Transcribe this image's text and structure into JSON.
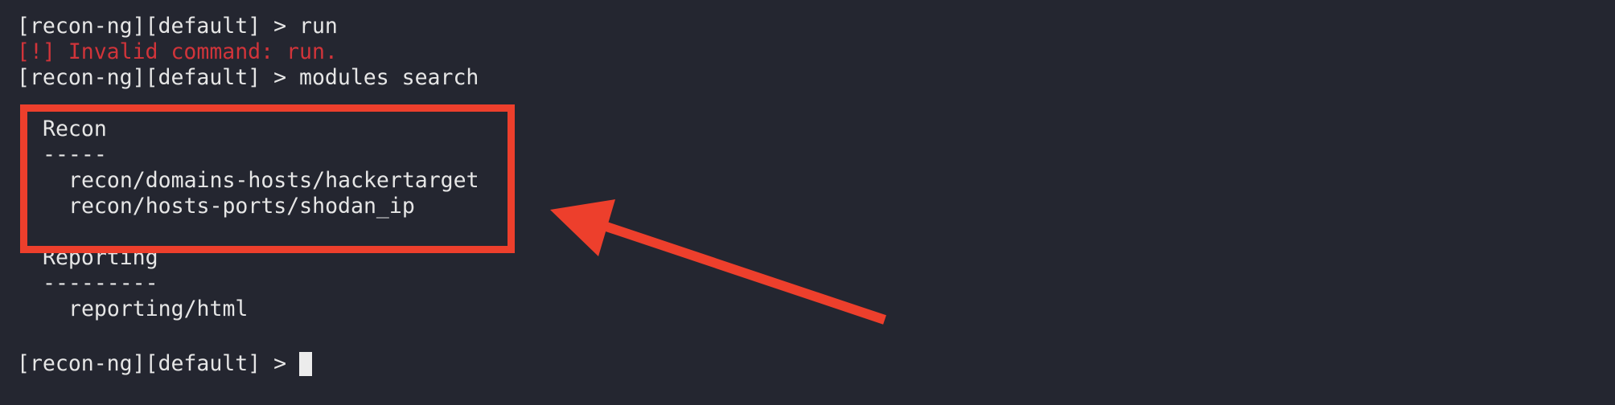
{
  "terminal": {
    "prompt_1": "[recon-ng][default] > run",
    "error_1": "[!] Invalid command: run.",
    "prompt_2": "[recon-ng][default] > modules search",
    "sections": [
      {
        "heading": "Recon",
        "underline": "-----",
        "modules": [
          "recon/domains-hosts/hackertarget",
          "recon/hosts-ports/shodan_ip"
        ]
      },
      {
        "heading": "Reporting",
        "underline": "---------",
        "modules": [
          "reporting/html"
        ]
      }
    ],
    "prompt_3": "[recon-ng][default] > "
  },
  "colors": {
    "background": "#242630",
    "text": "#e6e6e6",
    "error": "#d1343a",
    "annotation": "#ed3f2c"
  },
  "annotation": {
    "box_target": "Recon section",
    "arrow_icon": "arrow-icon"
  }
}
